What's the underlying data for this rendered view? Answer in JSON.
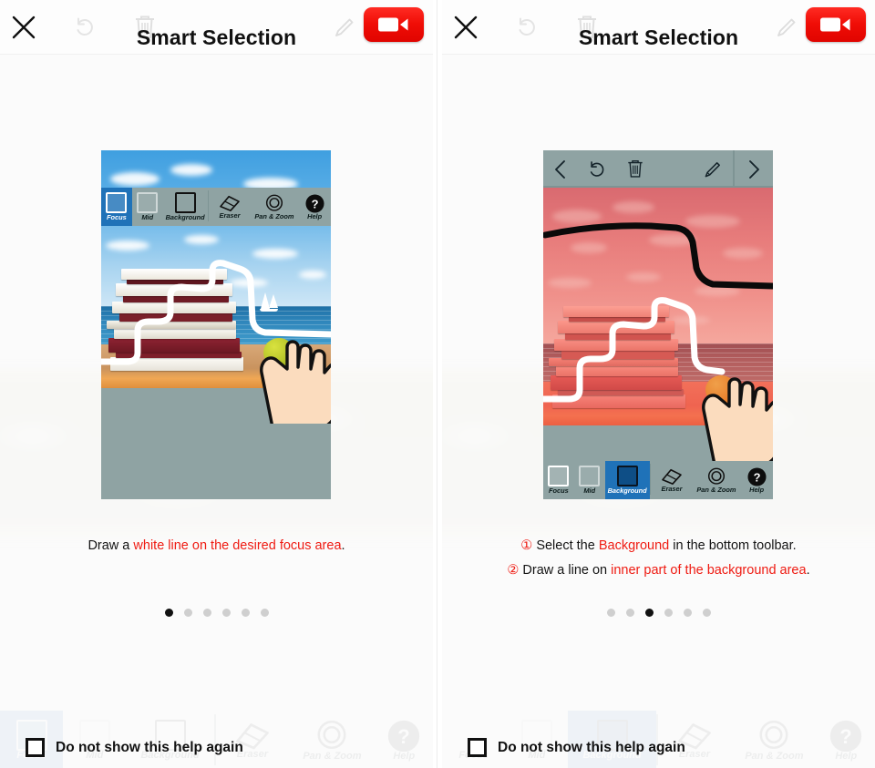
{
  "app": {
    "title": "Smart Selection",
    "accent_red": "#ef1b12",
    "toolbar_bg": "#8fa3a3",
    "selected_blue": "#1f72b8"
  },
  "header": {
    "title": "Smart Selection",
    "close_icon": "close-icon",
    "undo_icon": "undo-icon",
    "trash_icon": "trash-icon",
    "pencil_icon": "pencil-icon",
    "record_icon": "video-camera-icon"
  },
  "mock_toolbar_top": {
    "back_icon": "chevron-left-icon",
    "undo_icon": "undo-icon",
    "trash_icon": "trash-icon",
    "pencil_icon": "pencil-icon",
    "forward_icon": "chevron-right-icon"
  },
  "mock_toolbar_bottom": {
    "tools": [
      {
        "label": "Focus",
        "icon": "square-outline-icon"
      },
      {
        "label": "Mid",
        "icon": "square-outline-icon"
      },
      {
        "label": "Background",
        "icon": "square-outline-icon"
      },
      {
        "label": "Eraser",
        "icon": "eraser-icon"
      },
      {
        "label": "Pan & Zoom",
        "icon": "pan-zoom-icon"
      },
      {
        "label": "Help",
        "icon": "help-icon"
      }
    ]
  },
  "panels": [
    {
      "id": "panel-1",
      "selected_tool": "Focus",
      "caption": {
        "line1_pre": "Draw a ",
        "line1_hl": "white line on the desired focus area",
        "line1_post": "."
      },
      "dots": {
        "count": 6,
        "active_index": 0
      }
    },
    {
      "id": "panel-2",
      "selected_tool": "Background",
      "caption": {
        "num1": "①",
        "line1_pre": " Select the ",
        "line1_hl": "Background",
        "line1_post": " in the bottom toolbar.",
        "num2": "②",
        "line2_pre": " Draw a line on ",
        "line2_hl": "inner part of the background area",
        "line2_post": "."
      },
      "dots": {
        "count": 6,
        "active_index": 2
      }
    }
  ],
  "bottom_bar": {
    "checkbox_label": "Do not show this help again",
    "checked": false
  }
}
